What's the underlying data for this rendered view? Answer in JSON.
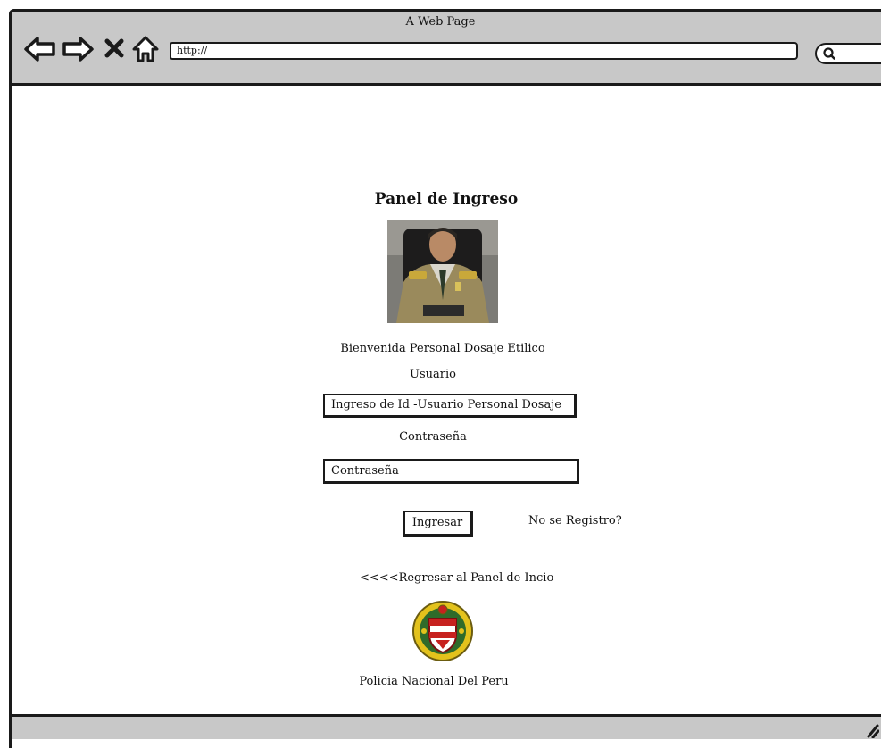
{
  "browser": {
    "window_title": "A Web Page",
    "url": "http://"
  },
  "page": {
    "heading": "Panel de Ingreso",
    "welcome_text": "Bienvenida Personal Dosaje Etilico",
    "username_label": "Usuario",
    "username_value": "Ingreso de Id -Usuario Personal Dosaje",
    "password_label": "Contraseña",
    "password_value": "Contraseña",
    "submit_label": "Ingresar",
    "register_link": "No se Registro?",
    "back_link": "<<<<Regresar al Panel de Incio",
    "footer_text": "Policia Nacional Del Peru"
  },
  "icons": {
    "back": "back-arrow-icon",
    "forward": "forward-arrow-icon",
    "stop": "close-icon",
    "home": "home-icon",
    "search": "search-icon",
    "resize": "resize-grip-icon"
  },
  "colors": {
    "chrome": "#c8c8c8",
    "outline": "#1a1a1a"
  }
}
